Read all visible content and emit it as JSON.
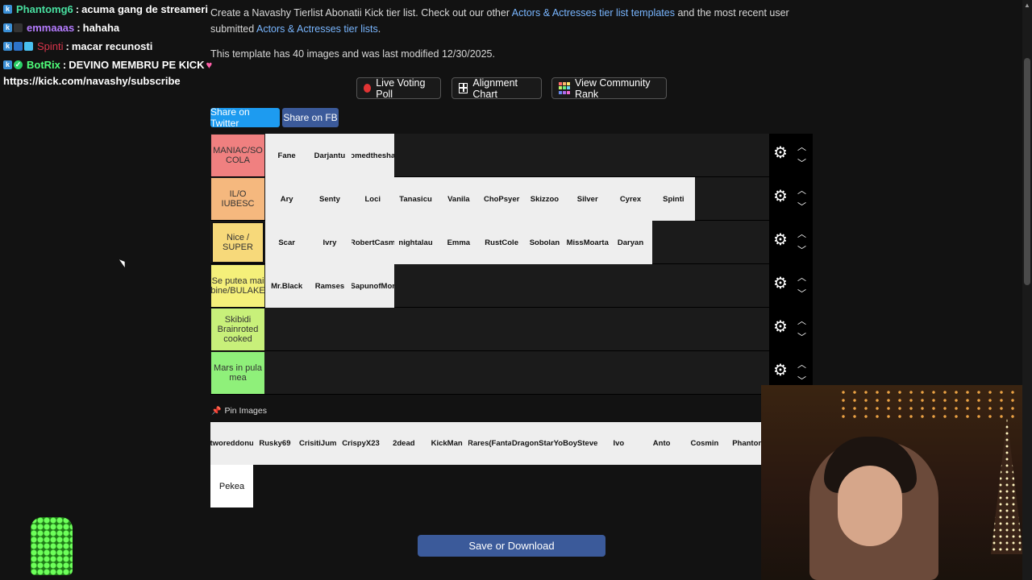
{
  "chat": {
    "messages": [
      {
        "user": "Phantomg6",
        "user_color": "#48e0a0",
        "text": "acuma gang de streameri"
      },
      {
        "user": "emmaaas",
        "user_color": "#b57cff",
        "text": "hahaha"
      },
      {
        "user": "Spinti",
        "user_color": "#d9344a",
        "text": "macar recunosti"
      },
      {
        "user": "BotRix",
        "user_color": "#4fff7a",
        "text": "DEVINO MEMBRU PE KICK"
      }
    ],
    "link": "https://kick.com/navashy/subscribe"
  },
  "intro": {
    "prefix": "Create a Navashy Tierlist Abonatii Kick tier list. Check out our other",
    "link1": "Actors & Actresses tier list templates",
    "middle": "and the most recent user submitted",
    "link2": "Actors & Actresses tier lists",
    "suffix": "."
  },
  "meta": "This template has 40 images and was last modified 12/30/2025.",
  "buttons": {
    "live_voting": "Live Voting Poll",
    "alignment": "Alignment Chart",
    "community_rank": "View Community Rank",
    "share_twitter": "Share on Twitter",
    "share_fb": "Share on FB",
    "save": "Save or Download"
  },
  "tiers": [
    {
      "label": "MANIAC/SO COLA",
      "color": "#f08080",
      "items": [
        "Fane",
        "Darjantu",
        "omedthesha"
      ]
    },
    {
      "label": "IL/O IUBESC",
      "color": "#f5b87e",
      "items": [
        "Ary",
        "Senty",
        "Loci",
        "Tanasicu",
        "Vanila",
        "ChoPsyer",
        "Skizzoo",
        "Silver",
        "Cyrex",
        "Spinti"
      ]
    },
    {
      "label": "Nice / SUPER",
      "color": "#f7d97a",
      "items": [
        "Scar",
        "Ivry",
        "RobertCasm",
        "nightalau",
        "Emma",
        "RustCole",
        "Sobolan",
        "MissMoarta",
        "Daryan"
      ]
    },
    {
      "label": "Se putea mai bine/BULAKE",
      "color": "#f5f07a",
      "items": [
        "Mr.Black",
        "Ramses",
        "SapunofMor"
      ]
    },
    {
      "label": "Skibidi Brainroted cooked",
      "color": "#c8f07a",
      "items": []
    },
    {
      "label": "Mars in pula mea",
      "color": "#8ff07a",
      "items": []
    }
  ],
  "pin_images_label": "Pin Images",
  "pool": [
    "tworeddonu",
    "Rusky69",
    "CrisitiJum",
    "CrispyX23",
    "2dead",
    "KickMan",
    "Rares(Fanta",
    "DragonStar",
    "YoBoySteve",
    "Ivo",
    "Anto",
    "Cosmin",
    "Phanton"
  ],
  "pool_row2": [
    "Pekea"
  ]
}
